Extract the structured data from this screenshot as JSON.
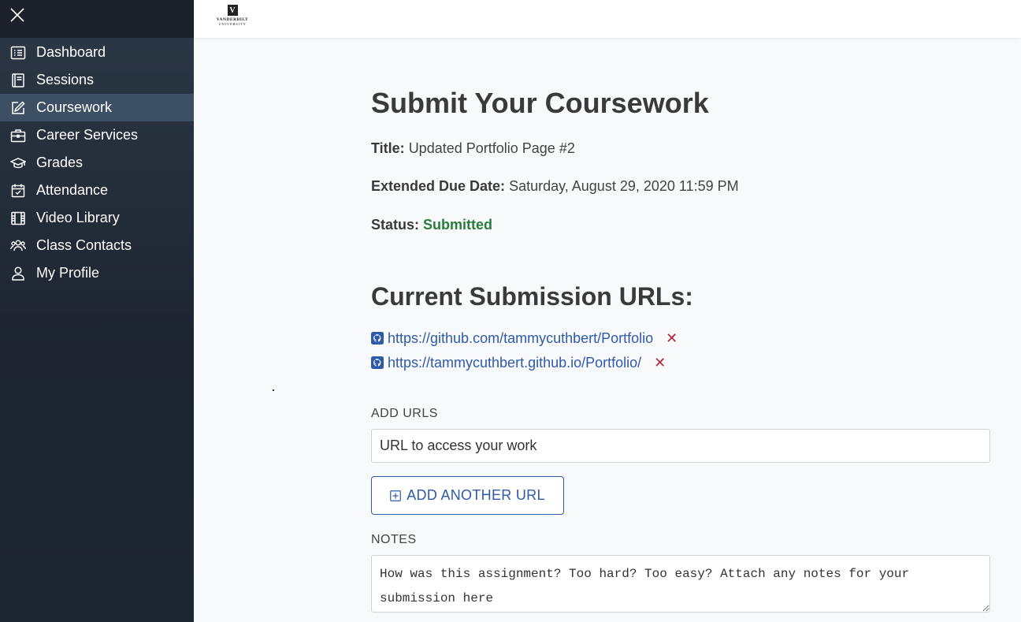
{
  "sidebar": {
    "items": [
      {
        "label": "Dashboard",
        "icon": "list-icon"
      },
      {
        "label": "Sessions",
        "icon": "book-icon"
      },
      {
        "label": "Coursework",
        "icon": "edit-icon",
        "active": true
      },
      {
        "label": "Career Services",
        "icon": "briefcase-icon"
      },
      {
        "label": "Grades",
        "icon": "graduation-cap-icon"
      },
      {
        "label": "Attendance",
        "icon": "calendar-check-icon"
      },
      {
        "label": "Video Library",
        "icon": "film-icon"
      },
      {
        "label": "Class Contacts",
        "icon": "people-icon"
      },
      {
        "label": "My Profile",
        "icon": "person-icon"
      }
    ]
  },
  "header": {
    "logo_mark": "V",
    "logo_line1": "VANDERBILT",
    "logo_line2": "UNIVERSITY"
  },
  "main": {
    "title": "Submit Your Coursework",
    "title_label": "Title:",
    "title_value": "Updated Portfolio Page #2",
    "due_label": "Extended Due Date:",
    "due_value": "Saturday, August 29, 2020 11:59 PM",
    "status_label": "Status:",
    "status_value": "Submitted",
    "submission_heading": "Current Submission URLs:",
    "urls": [
      "https://github.com/tammycuthbert/Portfolio",
      "https://tammycuthbert.github.io/Portfolio/"
    ],
    "remove_glyph": "✕",
    "add_urls_label": "ADD URLS",
    "url_placeholder": "URL to access your work",
    "add_button_label": "ADD ANOTHER URL",
    "notes_label": "NOTES",
    "notes_placeholder": "How was this assignment? Too hard? Too easy? Attach any notes for your submission here"
  },
  "colors": {
    "sidebar_bg": "#1d2731",
    "active_item": "#3d4f63",
    "link": "#2f5aa8",
    "status_green": "#2a7c3b",
    "remove_red": "#b02a37"
  }
}
